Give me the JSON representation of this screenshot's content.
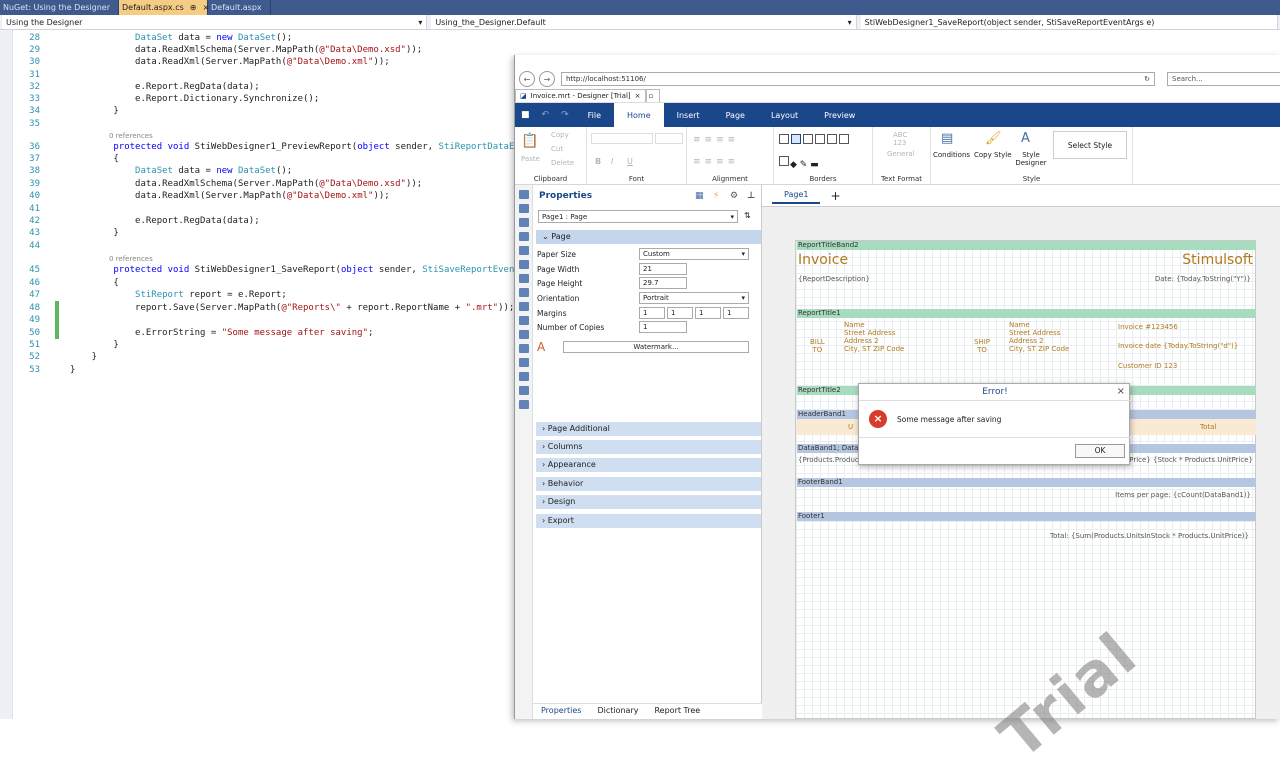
{
  "vs": {
    "tabs": [
      {
        "label": "NuGet: Using the Designer",
        "active": false
      },
      {
        "label": "Default.aspx.cs",
        "active": true
      },
      {
        "label": "Default.aspx",
        "active": false
      }
    ],
    "nav": [
      "Using the Designer",
      "Using_the_Designer.Default",
      "StiWebDesigner1_SaveReport(object sender, StiSaveReportEventArgs e)"
    ],
    "ref_label": "0 references"
  },
  "code_lines": [
    {
      "n": "28",
      "t": "            DataSet data = new DataSet();"
    },
    {
      "n": "29",
      "t": "            data.ReadXmlSchema(Server.MapPath(@\"Data\\Demo.xsd\"));"
    },
    {
      "n": "30",
      "t": "            data.ReadXml(Server.MapPath(@\"Data\\Demo.xml\"));"
    },
    {
      "n": "31",
      "t": ""
    },
    {
      "n": "32",
      "t": "            e.Report.RegData(data);"
    },
    {
      "n": "33",
      "t": "            e.Report.Dictionary.Synchronize();"
    },
    {
      "n": "34",
      "t": "        }"
    },
    {
      "n": "35",
      "t": ""
    },
    {
      "n": "36",
      "t": "        protected void StiWebDesigner1_PreviewReport(object sender, StiReportDataEve"
    },
    {
      "n": "37",
      "t": "        {"
    },
    {
      "n": "38",
      "t": "            DataSet data = new DataSet();"
    },
    {
      "n": "39",
      "t": "            data.ReadXmlSchema(Server.MapPath(@\"Data\\Demo.xsd\"));"
    },
    {
      "n": "40",
      "t": "            data.ReadXml(Server.MapPath(@\"Data\\Demo.xml\"));"
    },
    {
      "n": "41",
      "t": ""
    },
    {
      "n": "42",
      "t": "            e.Report.RegData(data);"
    },
    {
      "n": "43",
      "t": "        }"
    },
    {
      "n": "44",
      "t": ""
    },
    {
      "n": "45",
      "t": "        protected void StiWebDesigner1_SaveReport(object sender, StiSaveReportEventA"
    },
    {
      "n": "46",
      "t": "        {"
    },
    {
      "n": "47",
      "t": "            StiReport report = e.Report;"
    },
    {
      "n": "48",
      "t": "            report.Save(Server.MapPath(@\"Reports\\\" + report.ReportName + \".mrt\"));"
    },
    {
      "n": "49",
      "t": ""
    },
    {
      "n": "50",
      "t": "            e.ErrorString = \"Some message after saving\";"
    },
    {
      "n": "51",
      "t": "        }"
    },
    {
      "n": "52",
      "t": "    }"
    },
    {
      "n": "53",
      "t": "}"
    }
  ],
  "browser": {
    "url": "http://localhost:51106/",
    "search_placeholder": "Search...",
    "tab_title": "Invoice.mrt - Designer [Trial]"
  },
  "designer": {
    "menu": [
      "File",
      "Home",
      "Insert",
      "Page",
      "Layout",
      "Preview"
    ],
    "ribbon": {
      "clipboard": {
        "paste": "Paste",
        "copy": "Copy",
        "cut": "Cut",
        "delete": "Delete",
        "label": "Clipboard"
      },
      "font_label": "Font",
      "alignment_label": "Alignment",
      "borders_label": "Borders",
      "text_format": {
        "abc": "ABC",
        "n": "123",
        "general": "General",
        "label": "Text Format"
      },
      "style": {
        "conditions": "Conditions",
        "copy_style": "Copy Style",
        "style_designer": "Style Designer",
        "select_style": "Select Style",
        "label": "Style"
      }
    },
    "properties": {
      "title": "Properties",
      "selector": "Page1 : Page",
      "page_cat": "Page",
      "rows": [
        {
          "label": "Paper Size",
          "value": "Custom"
        },
        {
          "label": "Page Width",
          "value": "21"
        },
        {
          "label": "Page Height",
          "value": "29.7"
        },
        {
          "label": "Orientation",
          "value": "Portrait"
        },
        {
          "label": "Margins",
          "value": "1"
        },
        {
          "label": "Number of Copies",
          "value": "1"
        }
      ],
      "margins": [
        "1",
        "1",
        "1",
        "1"
      ],
      "watermark": "Watermark...",
      "categories": [
        "Page Additional",
        "Columns",
        "Appearance",
        "Behavior",
        "Design",
        "Export"
      ]
    },
    "bottom_tabs": [
      "Properties",
      "Dictionary",
      "Report Tree"
    ],
    "page_tab": "Page1",
    "page_add": "+",
    "report": {
      "bands": {
        "title2": "ReportTitleBand2",
        "title1": "ReportTitle1",
        "title_2": "ReportTitle2",
        "header": "HeaderBand1",
        "data": "DataBand1; Data S",
        "footer": "FooterBand1",
        "footer1": "Footer1"
      },
      "invoice": "Invoice",
      "brand": "Stimulsoft",
      "desc": "{ReportDescription}",
      "date": "Date: {Today.ToString(\"Y\")}",
      "bill": "BILL",
      "bill_to": "TO",
      "ship": "SHIP",
      "ship_to": "TO",
      "addr": [
        "Name",
        "Street Address",
        "Address 2",
        "City, ST  ZIP Code"
      ],
      "inv_no": "Invoice #123456",
      "inv_date": "Invoice date {Today.ToString(\"d\")}",
      "cust": "Customer ID 123",
      "header_u": "U",
      "header_total": "Total",
      "data_left": "{Products.Product",
      "data_right": "UnitPrice} {Stock * Products.UnitPrice}",
      "items_per_page": "Items per page: {cCount(DataBand1)}",
      "total": "Total: {Sum(Products.UnitsInStock * Products.UnitPrice)}",
      "trial": "Trial"
    },
    "dialog": {
      "title": "Error!",
      "message": "Some message after saving",
      "ok": "OK"
    }
  }
}
